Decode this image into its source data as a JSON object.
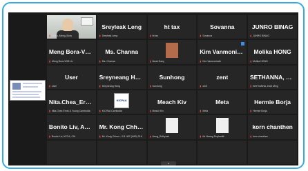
{
  "participants": [
    {
      "name": "",
      "label": "Video_Meng_Bora"
    },
    {
      "name": "Sreyleak Leng",
      "label": "Sreyleak Leng"
    },
    {
      "name": "ht tax",
      "label": "ht tax"
    },
    {
      "name": "Sovanna",
      "label": "Sovanna"
    },
    {
      "name": "JUNRO BINAG",
      "label": "JUNRO BINAG"
    },
    {
      "name": "Meng Bora-VDB...",
      "label": "Meng Bora-VDB LLi"
    },
    {
      "name": "Ms. Channa",
      "label": "Ms. Channa"
    },
    {
      "name": "",
      "label": "Neak Dany"
    },
    {
      "name": "Kim Vanmonirath",
      "label": "Kim Vanmonirath"
    },
    {
      "name": "Molika HONG",
      "label": "Molika HONG"
    },
    {
      "name": "User",
      "label": "User"
    },
    {
      "name": "Sreyneang Heng",
      "label": "Sreyneang Heng"
    },
    {
      "name": "Sunhong",
      "label": "Sunhong"
    },
    {
      "name": "zent",
      "label": "zent"
    },
    {
      "name": "SETHANNA, East...",
      "label": "SETHANNA, East Ming"
    },
    {
      "name": "Nita.Chea_Ernst...",
      "label": "Nita.Chea Ernst & Young Cambodia"
    },
    {
      "name": "",
      "label": "KICPAA Cambodia"
    },
    {
      "name": "Meach Kiv",
      "label": "Meach Kiv"
    },
    {
      "name": "Meta",
      "label": "Meta"
    },
    {
      "name": "Hermie Borja",
      "label": "Hermie Borja"
    },
    {
      "name": "Bonito Liv, ACCA...",
      "label": "Bonito Liv, ACCA, CIA"
    },
    {
      "name": "Mr. Kong Chhun...",
      "label": "Mr. Kong Chhun - 011 467 (KAB) 016"
    },
    {
      "name": "",
      "label": "Heng_Sothyrak"
    },
    {
      "name": "",
      "label": "Mr Neang Sophanith"
    },
    {
      "name": "korn chanthen",
      "label": "korn chanthen"
    }
  ],
  "logo_text": "KICPAA"
}
